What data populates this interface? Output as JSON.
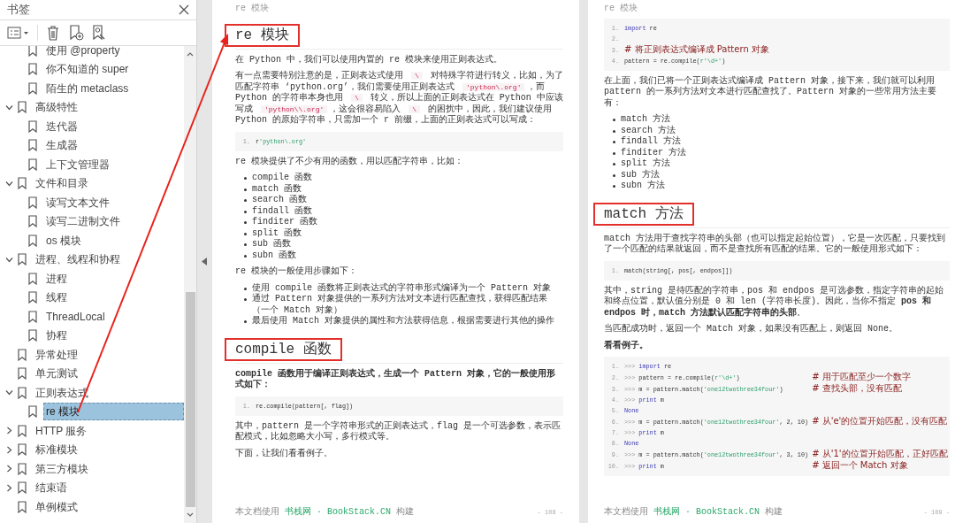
{
  "sidebar": {
    "title": "书签",
    "continued_children": [
      {
        "label": "使用 @property",
        "selected": false
      },
      {
        "label": "你不知道的 super",
        "selected": false
      },
      {
        "label": "陌生的 metaclass",
        "selected": false
      }
    ],
    "items": [
      {
        "label": "高级特性",
        "expanded": true,
        "selected": false,
        "children": [
          {
            "label": "迭代器",
            "selected": false
          },
          {
            "label": "生成器",
            "selected": false
          },
          {
            "label": "上下文管理器",
            "selected": false
          }
        ]
      },
      {
        "label": "文件和目录",
        "expanded": true,
        "selected": false,
        "children": [
          {
            "label": "读写文本文件",
            "selected": false
          },
          {
            "label": "读写二进制文件",
            "selected": false
          },
          {
            "label": "os 模块",
            "selected": false
          }
        ]
      },
      {
        "label": "进程、线程和协程",
        "expanded": true,
        "selected": false,
        "children": [
          {
            "label": "进程",
            "selected": false
          },
          {
            "label": "线程",
            "selected": false
          },
          {
            "label": "ThreadLocal",
            "selected": false
          },
          {
            "label": "协程",
            "selected": false
          }
        ]
      },
      {
        "label": "异常处理",
        "selected": false
      },
      {
        "label": "单元测试",
        "selected": false
      },
      {
        "label": "正则表达式",
        "expanded": true,
        "selected": false,
        "children": [
          {
            "label": "re 模块",
            "selected": true
          }
        ]
      },
      {
        "label": "HTTP 服务",
        "expanded": false,
        "selected": false
      },
      {
        "label": "标准模块",
        "expanded": false,
        "selected": false
      },
      {
        "label": "第三方模块",
        "expanded": false,
        "selected": false
      },
      {
        "label": "结束语",
        "expanded": false,
        "selected": false
      },
      {
        "label": "单例模式",
        "selected": false
      }
    ]
  },
  "pages": [
    {
      "header": "re 模块",
      "blocks": [
        {
          "kind": "heading",
          "text": "re 模块",
          "boxed": true
        },
        {
          "kind": "paragraph",
          "parts": [
            {
              "text": "在 Python 中，我们可以使用内置的 re 模块来使用正则表达式。"
            }
          ]
        },
        {
          "kind": "paragraph",
          "parts": [
            {
              "text": "有一点需要特别注意的是，正则表达式使用 "
            },
            {
              "code": "\\"
            },
            {
              "text": " 对特殊字符进行转义，比如，为了匹配字符串 ‘python.org’，我们需要使用正则表达式 "
            },
            {
              "code": "'python\\.org'"
            },
            {
              "text": "，而 Python 的字符串本身也用 "
            },
            {
              "code": "\\"
            },
            {
              "text": " 转义，所以上面的正则表达式在 Python 中应该写成 "
            },
            {
              "code": "'python\\\\.org'"
            },
            {
              "text": "，这会很容易陷入 "
            },
            {
              "code": "\\"
            },
            {
              "text": " 的困扰中，因此，我们建议使用 Python 的原始字符串，只需加一个 r 前缀，上面的正则表达式可以写成："
            }
          ]
        },
        {
          "kind": "code",
          "lines": [
            {
              "n": "1.",
              "tokens": [
                {
                  "text": "r"
                },
                {
                  "str": "'python\\.org'"
                }
              ]
            }
          ]
        },
        {
          "kind": "paragraph",
          "parts": [
            {
              "text": "re 模块提供了不少有用的函数，用以匹配字符串，比如："
            }
          ]
        },
        {
          "kind": "list",
          "items": [
            [
              {
                "text": "compile 函数"
              }
            ],
            [
              {
                "text": "match 函数"
              }
            ],
            [
              {
                "text": "search 函数"
              }
            ],
            [
              {
                "text": "findall 函数"
              }
            ],
            [
              {
                "text": "finditer 函数"
              }
            ],
            [
              {
                "text": "split 函数"
              }
            ],
            [
              {
                "text": "sub 函数"
              }
            ],
            [
              {
                "text": "subn 函数"
              }
            ]
          ]
        },
        {
          "kind": "paragraph",
          "parts": [
            {
              "text": "re 模块的一般使用步骤如下："
            }
          ]
        },
        {
          "kind": "list",
          "items": [
            [
              {
                "text": "使用 compile 函数将正则表达式的字符串形式编译为一个 Pattern 对象"
              }
            ],
            [
              {
                "text": "通过 Pattern 对象提供的一系列方法对文本进行匹配查找，获得匹配结果（一个 Match 对象）"
              }
            ],
            [
              {
                "text": "最后使用 Match 对象提供的属性和方法获得信息，根据需要进行其他的操作"
              }
            ]
          ]
        },
        {
          "kind": "heading",
          "text": "compile 函数",
          "boxed": true
        },
        {
          "kind": "paragraph",
          "bold": true,
          "parts": [
            {
              "text": "compile 函数用于编译正则表达式，生成一个 Pattern 对象，它的一般使用形式如下："
            }
          ]
        },
        {
          "kind": "code",
          "lines": [
            {
              "n": "1.",
              "tokens": [
                {
                  "text": "re.compile(pattern[, flag])"
                }
              ]
            }
          ]
        },
        {
          "kind": "paragraph",
          "parts": [
            {
              "text": "其中，pattern 是一个字符串形式的正则表达式，flag 是一个可选参数，表示匹配模式，比如忽略大小写，多行模式等。"
            }
          ]
        },
        {
          "kind": "paragraph",
          "parts": [
            {
              "text": "下面，让我们看看例子。"
            }
          ]
        }
      ],
      "footer": {
        "parts": [
          {
            "text": "本文档使用 "
          },
          {
            "link": "书栈网 · BookStack.CN"
          },
          {
            "text": " 构建"
          }
        ],
        "page_number": "- 108 -"
      }
    },
    {
      "header": "re 模块",
      "blocks": [
        {
          "kind": "code",
          "lines": [
            {
              "n": "1.",
              "tokens": [
                {
                  "kw": "import"
                },
                {
                  "text": " re"
                }
              ]
            },
            {
              "n": "2."
            },
            {
              "n": "3.",
              "tokens": [
                {
                  "comment": "# 将正则表达式编译成 Pattern 对象"
                }
              ]
            },
            {
              "n": "4.",
              "tokens": [
                {
                  "text": "pattern = re.compile("
                },
                {
                  "str": "r'\\d+'"
                },
                {
                  "text": ")"
                }
              ]
            }
          ]
        },
        {
          "kind": "paragraph",
          "parts": [
            {
              "text": "在上面，我们已将一个正则表达式编译成 Pattern 对象，接下来，我们就可以利用 pattern 的一系列方法对文本进行匹配查找了。Pattern 对象的一些常用方法主要有："
            }
          ]
        },
        {
          "kind": "list",
          "items": [
            [
              {
                "text": "match 方法"
              }
            ],
            [
              {
                "text": "search 方法"
              }
            ],
            [
              {
                "text": "findall 方法"
              }
            ],
            [
              {
                "text": "finditer 方法"
              }
            ],
            [
              {
                "text": "split 方法"
              }
            ],
            [
              {
                "text": "sub 方法"
              }
            ],
            [
              {
                "text": "subn 方法"
              }
            ]
          ]
        },
        {
          "kind": "heading",
          "text": "match 方法",
          "boxed": true
        },
        {
          "kind": "paragraph",
          "parts": [
            {
              "text": "match 方法用于查找字符串的头部（也可以指定起始位置），它是一次匹配，只要找到了一个匹配的结果就返回，而不是查找所有匹配的结果。它的一般使用形式如下："
            }
          ]
        },
        {
          "kind": "code",
          "lines": [
            {
              "n": "1.",
              "tokens": [
                {
                  "text": "match(string[, pos[, endpos]])"
                }
              ]
            }
          ]
        },
        {
          "kind": "paragraph",
          "parts": [
            {
              "text": "其中，string 是待匹配的字符串，pos 和 endpos 是可选参数，指定字符串的起始和终点位置，默认值分别是 0 和 len (字符串长度)。因此，当你不指定 "
            },
            {
              "bold": "pos 和 endpos 时，match 方法默认匹配字符串的头部"
            },
            {
              "text": "。"
            }
          ]
        },
        {
          "kind": "paragraph",
          "parts": [
            {
              "text": "当匹配成功时，返回一个 Match 对象，如果没有匹配上，则返回 None。"
            }
          ]
        },
        {
          "kind": "paragraph",
          "bold": true,
          "parts": [
            {
              "text": "看看例子。"
            }
          ]
        },
        {
          "kind": "code",
          "lines": [
            {
              "n": "1.",
              "tokens": [
                {
                  "prompt": ">>> "
                },
                {
                  "kw": "import"
                },
                {
                  "text": " re"
                }
              ]
            },
            {
              "n": "2.",
              "tokens": [
                {
                  "prompt": ">>> "
                },
                {
                  "text": "pattern = re.compile("
                },
                {
                  "str": "r'\\d+'"
                },
                {
                  "text": ")                    "
                },
                {
                  "comment": "# 用于匹配至少一个数字"
                }
              ]
            },
            {
              "n": "3.",
              "tokens": [
                {
                  "prompt": ">>> "
                },
                {
                  "text": "m = pattern.match("
                },
                {
                  "str": "'one12twothree34four'"
                },
                {
                  "text": ")        "
                },
                {
                  "comment": "# 查找头部，没有匹配"
                }
              ]
            },
            {
              "n": "4.",
              "tokens": [
                {
                  "prompt": ">>> "
                },
                {
                  "kw": "print"
                },
                {
                  "text": " m"
                }
              ]
            },
            {
              "n": "5.",
              "tokens": [
                {
                  "kw": "None"
                }
              ]
            },
            {
              "n": "6.",
              "tokens": [
                {
                  "prompt": ">>> "
                },
                {
                  "text": "m = pattern.match("
                },
                {
                  "str": "'one12twothree34four'"
                },
                {
                  "text": ", 2, 10) "
                },
                {
                  "comment": "# 从'e'的位置开始匹配，没有匹配"
                }
              ]
            },
            {
              "n": "7.",
              "tokens": [
                {
                  "prompt": ">>> "
                },
                {
                  "kw": "print"
                },
                {
                  "text": " m"
                }
              ]
            },
            {
              "n": "8.",
              "tokens": [
                {
                  "kw": "None"
                }
              ]
            },
            {
              "n": "9.",
              "tokens": [
                {
                  "prompt": ">>> "
                },
                {
                  "text": "m = pattern.match("
                },
                {
                  "str": "'one12twothree34four'"
                },
                {
                  "text": ", 3, 10) "
                },
                {
                  "comment": "# 从'1'的位置开始匹配，正好匹配"
                }
              ]
            },
            {
              "n": "10.",
              "tokens": [
                {
                  "prompt": ">>> "
                },
                {
                  "kw": "print"
                },
                {
                  "text": " m                                         "
                },
                {
                  "comment": "# 返回一个 Match 对象"
                }
              ]
            }
          ]
        }
      ],
      "footer": {
        "parts": [
          {
            "text": "本文档使用 "
          },
          {
            "link": "书栈网 · BookStack.CN"
          },
          {
            "text": " 构建"
          }
        ],
        "page_number": "- 109 -"
      }
    }
  ]
}
